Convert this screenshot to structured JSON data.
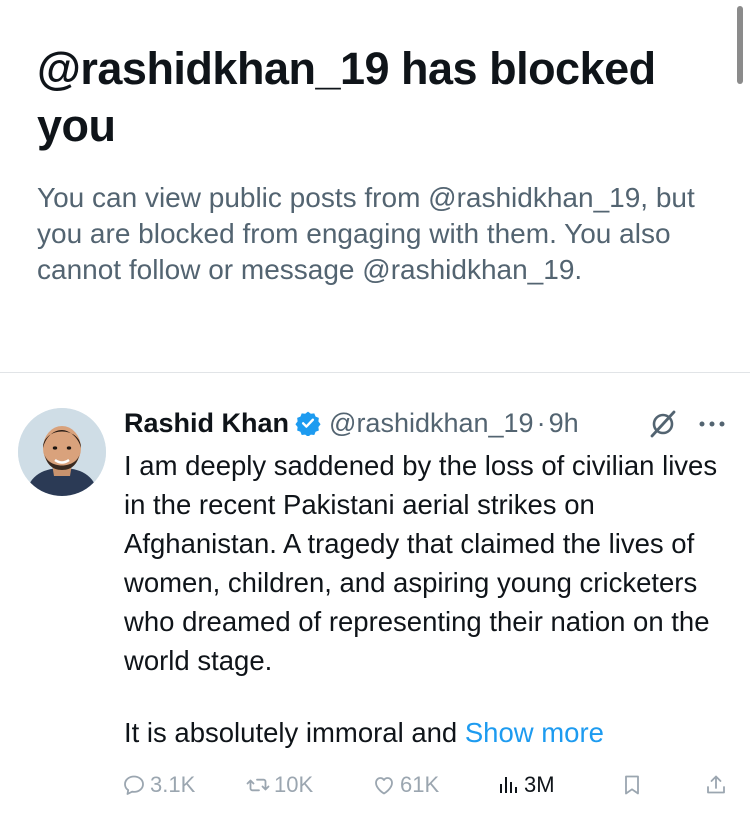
{
  "block_notice": {
    "title": "@rashidkhan_19 has blocked you",
    "description": "You can view public posts from @rashidkhan_19, but you are blocked from engaging with them. You also cannot follow or message @rashidkhan_19."
  },
  "post": {
    "display_name": "Rashid Khan",
    "handle": "@rashidkhan_19",
    "separator": "·",
    "time": "9h",
    "text": "I am deeply saddened by the loss of civilian lives in the recent Pakistani aerial strikes on Afghanistan. A tragedy that claimed the lives of women, children, and aspiring young cricketers who dreamed of representing their nation on the world stage.",
    "text_continued": "It is absolutely immoral and",
    "show_more_label": "Show more",
    "actions": {
      "replies": "3.1K",
      "reposts": "10K",
      "likes": "61K",
      "views": "3M"
    }
  },
  "colors": {
    "accent": "#1d9bf0",
    "secondary_text": "#536471",
    "disabled_action": "#9ba6b0"
  },
  "icons": [
    "verified-badge-icon",
    "grok-icon",
    "more-icon",
    "reply-icon",
    "repost-icon",
    "like-icon",
    "views-icon",
    "bookmark-icon",
    "share-icon"
  ]
}
